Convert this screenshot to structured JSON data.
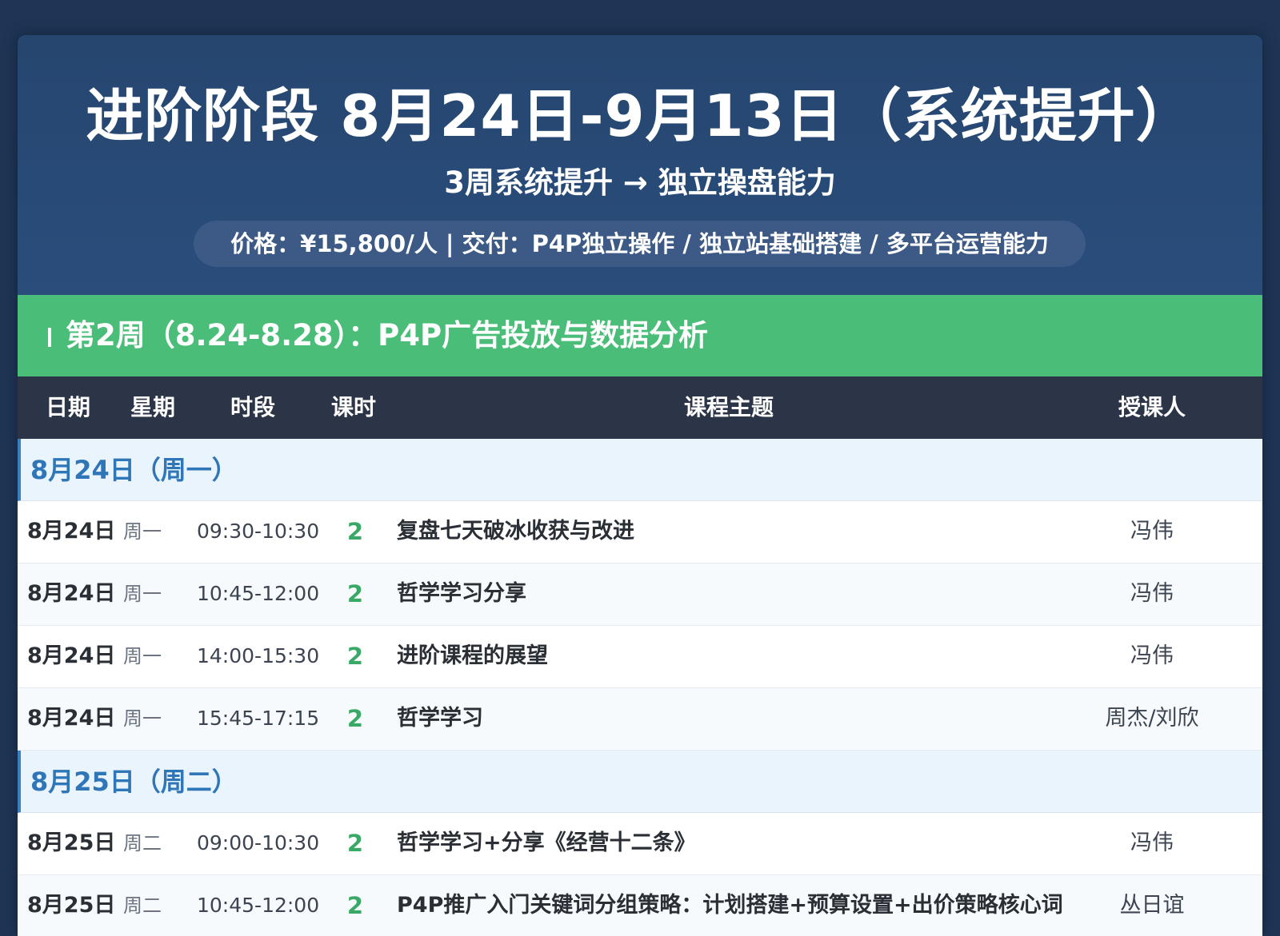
{
  "header": {
    "title": "进阶阶段 8月24日-9月13日（系统提升）",
    "subtitle": "3周系统提升 → 独立操盘能力",
    "price_line": "价格：¥15,800/人 | 交付：P4P独立操作 / 独立站基础搭建 / 多平台运营能力"
  },
  "week_bar": {
    "label": "第2周（8.24-8.28）：P4P广告投放与数据分析"
  },
  "table": {
    "columns": {
      "date": "日期",
      "weekday": "星期",
      "time": "时段",
      "hours": "课时",
      "topic": "课程主题",
      "teacher": "授课人"
    },
    "days": [
      {
        "label": "8月24日（周一）",
        "rows": [
          {
            "date": "8月24日",
            "weekday": "周一",
            "time": "09:30-10:30",
            "hours": "2",
            "topic": "复盘七天破冰收获与改进",
            "teacher": "冯伟"
          },
          {
            "date": "8月24日",
            "weekday": "周一",
            "time": "10:45-12:00",
            "hours": "2",
            "topic": "哲学学习分享",
            "teacher": "冯伟"
          },
          {
            "date": "8月24日",
            "weekday": "周一",
            "time": "14:00-15:30",
            "hours": "2",
            "topic": "进阶课程的展望",
            "teacher": "冯伟"
          },
          {
            "date": "8月24日",
            "weekday": "周一",
            "time": "15:45-17:15",
            "hours": "2",
            "topic": "哲学学习",
            "teacher": "周杰/刘欣"
          }
        ]
      },
      {
        "label": "8月25日（周二）",
        "rows": [
          {
            "date": "8月25日",
            "weekday": "周二",
            "time": "09:00-10:30",
            "hours": "2",
            "topic": "哲学学习+分享《经营十二条》",
            "teacher": "冯伟"
          },
          {
            "date": "8月25日",
            "weekday": "周二",
            "time": "10:45-12:00",
            "hours": "2",
            "topic": "P4P推广入门关键词分组策略：计划搭建+预算设置+出价策略核心词",
            "teacher": "丛日谊"
          }
        ]
      }
    ]
  }
}
